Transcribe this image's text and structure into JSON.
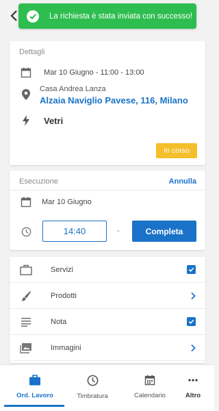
{
  "toast": {
    "message": "La richiesta è stata inviata con successo!"
  },
  "details": {
    "section_title": "Dettagli",
    "datetime": "Mar 10 Giugno - 11:00 - 13:00",
    "client": "Casa Andrea Lanza",
    "address": "Alzaia Naviglio Pavese, 116, Milano",
    "technician": "Vetri",
    "status": "In corso"
  },
  "execution": {
    "section_title": "Esecuzione",
    "cancel_label": "Annulla",
    "date": "Mar 10 Giugno",
    "time_value": "14:40",
    "separator": "-",
    "complete_label": "Completa"
  },
  "items": [
    {
      "label": "Servizi",
      "icon": "briefcase-icon",
      "action": "checked"
    },
    {
      "label": "Prodotti",
      "icon": "brush-icon",
      "action": "chevron"
    },
    {
      "label": "Nota",
      "icon": "notes-icon",
      "action": "checked"
    },
    {
      "label": "Immagini",
      "icon": "image-icon",
      "action": "chevron"
    }
  ],
  "nav": {
    "tabs": [
      {
        "label": "Ord. Lavoro",
        "icon": "briefcase-icon",
        "active": true
      },
      {
        "label": "Timbratura",
        "icon": "clock-icon",
        "active": false
      },
      {
        "label": "Calendario",
        "icon": "calendar-icon",
        "active": false
      },
      {
        "label": "Altro",
        "icon": "more-icon",
        "active": false
      }
    ]
  },
  "colors": {
    "accent": "#1a73c8",
    "success": "#2ebd4f",
    "status": "#f5be2b"
  }
}
